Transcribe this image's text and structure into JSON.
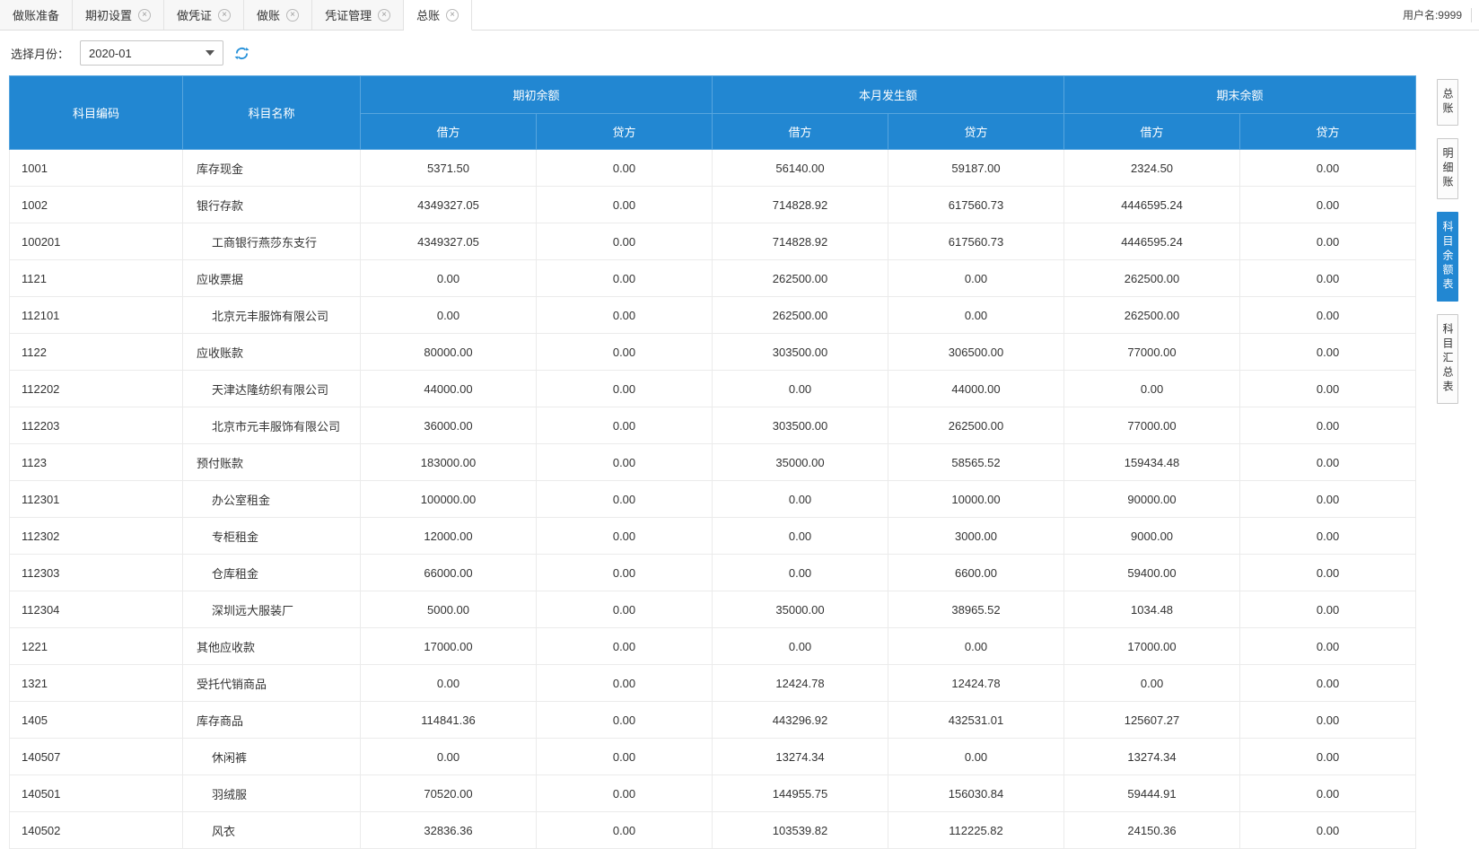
{
  "colors": {
    "accent_blue": "#2287d2"
  },
  "header": {
    "tabs": [
      {
        "label": "做账准备",
        "closable": false,
        "active": false
      },
      {
        "label": "期初设置",
        "closable": true,
        "active": false
      },
      {
        "label": "做凭证",
        "closable": true,
        "active": false
      },
      {
        "label": "做账",
        "closable": true,
        "active": false
      },
      {
        "label": "凭证管理",
        "closable": true,
        "active": false
      },
      {
        "label": "总账",
        "closable": true,
        "active": true
      }
    ],
    "user_label": "用户名:9999"
  },
  "filter": {
    "month_label": "选择月份：",
    "month_value": "2020-01"
  },
  "table": {
    "headers": {
      "code": "科目编码",
      "name": "科目名称",
      "groups": [
        "期初余额",
        "本月发生额",
        "期末余额"
      ],
      "debit": "借方",
      "credit": "贷方"
    },
    "rows": [
      {
        "code": "1001",
        "name": "库存现金",
        "indent": false,
        "values": [
          "5371.50",
          "0.00",
          "56140.00",
          "59187.00",
          "2324.50",
          "0.00"
        ]
      },
      {
        "code": "1002",
        "name": "银行存款",
        "indent": false,
        "values": [
          "4349327.05",
          "0.00",
          "714828.92",
          "617560.73",
          "4446595.24",
          "0.00"
        ]
      },
      {
        "code": "100201",
        "name": "工商银行燕莎东支行",
        "indent": true,
        "values": [
          "4349327.05",
          "0.00",
          "714828.92",
          "617560.73",
          "4446595.24",
          "0.00"
        ]
      },
      {
        "code": "1121",
        "name": "应收票据",
        "indent": false,
        "values": [
          "0.00",
          "0.00",
          "262500.00",
          "0.00",
          "262500.00",
          "0.00"
        ]
      },
      {
        "code": "112101",
        "name": "北京元丰服饰有限公司",
        "indent": true,
        "values": [
          "0.00",
          "0.00",
          "262500.00",
          "0.00",
          "262500.00",
          "0.00"
        ]
      },
      {
        "code": "1122",
        "name": "应收账款",
        "indent": false,
        "values": [
          "80000.00",
          "0.00",
          "303500.00",
          "306500.00",
          "77000.00",
          "0.00"
        ]
      },
      {
        "code": "112202",
        "name": "天津达隆纺织有限公司",
        "indent": true,
        "values": [
          "44000.00",
          "0.00",
          "0.00",
          "44000.00",
          "0.00",
          "0.00"
        ]
      },
      {
        "code": "112203",
        "name": "北京市元丰服饰有限公司",
        "indent": true,
        "values": [
          "36000.00",
          "0.00",
          "303500.00",
          "262500.00",
          "77000.00",
          "0.00"
        ]
      },
      {
        "code": "1123",
        "name": "预付账款",
        "indent": false,
        "values": [
          "183000.00",
          "0.00",
          "35000.00",
          "58565.52",
          "159434.48",
          "0.00"
        ]
      },
      {
        "code": "112301",
        "name": "办公室租金",
        "indent": true,
        "values": [
          "100000.00",
          "0.00",
          "0.00",
          "10000.00",
          "90000.00",
          "0.00"
        ]
      },
      {
        "code": "112302",
        "name": "专柜租金",
        "indent": true,
        "values": [
          "12000.00",
          "0.00",
          "0.00",
          "3000.00",
          "9000.00",
          "0.00"
        ]
      },
      {
        "code": "112303",
        "name": "仓库租金",
        "indent": true,
        "values": [
          "66000.00",
          "0.00",
          "0.00",
          "6600.00",
          "59400.00",
          "0.00"
        ]
      },
      {
        "code": "112304",
        "name": "深圳远大服装厂",
        "indent": true,
        "values": [
          "5000.00",
          "0.00",
          "35000.00",
          "38965.52",
          "1034.48",
          "0.00"
        ]
      },
      {
        "code": "1221",
        "name": "其他应收款",
        "indent": false,
        "values": [
          "17000.00",
          "0.00",
          "0.00",
          "0.00",
          "17000.00",
          "0.00"
        ]
      },
      {
        "code": "1321",
        "name": "受托代销商品",
        "indent": false,
        "values": [
          "0.00",
          "0.00",
          "12424.78",
          "12424.78",
          "0.00",
          "0.00"
        ]
      },
      {
        "code": "1405",
        "name": "库存商品",
        "indent": false,
        "values": [
          "114841.36",
          "0.00",
          "443296.92",
          "432531.01",
          "125607.27",
          "0.00"
        ]
      },
      {
        "code": "140507",
        "name": "休闲裤",
        "indent": true,
        "values": [
          "0.00",
          "0.00",
          "13274.34",
          "0.00",
          "13274.34",
          "0.00"
        ]
      },
      {
        "code": "140501",
        "name": "羽绒服",
        "indent": true,
        "values": [
          "70520.00",
          "0.00",
          "144955.75",
          "156030.84",
          "59444.91",
          "0.00"
        ]
      },
      {
        "code": "140502",
        "name": "风衣",
        "indent": true,
        "values": [
          "32836.36",
          "0.00",
          "103539.82",
          "112225.82",
          "24150.36",
          "0.00"
        ]
      }
    ]
  },
  "side_tabs": [
    {
      "label": "总账",
      "active": false
    },
    {
      "label": "明细账",
      "active": false
    },
    {
      "label": "科目余额表",
      "active": true
    },
    {
      "label": "科目汇总表",
      "active": false
    }
  ]
}
